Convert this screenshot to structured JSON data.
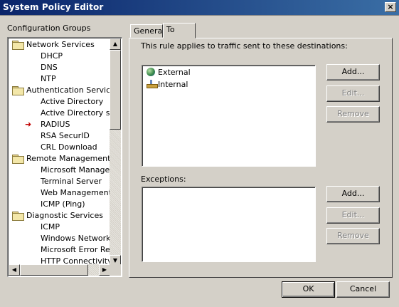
{
  "window": {
    "title": "System Policy Editor",
    "close_glyph": "×"
  },
  "sidebar": {
    "label": "Configuration Groups",
    "items": [
      {
        "text": "Network Services",
        "kind": "folder",
        "level": 0
      },
      {
        "text": "DHCP",
        "kind": "item",
        "level": 1
      },
      {
        "text": "DNS",
        "kind": "item",
        "level": 1
      },
      {
        "text": "NTP",
        "kind": "item",
        "level": 1
      },
      {
        "text": "Authentication Services",
        "kind": "folder",
        "level": 0
      },
      {
        "text": "Active Directory",
        "kind": "item",
        "level": 1
      },
      {
        "text": "Active Directory serv",
        "kind": "item",
        "level": 1
      },
      {
        "text": "RADIUS",
        "kind": "item",
        "level": 1,
        "selected_marker": true
      },
      {
        "text": "RSA SecurID",
        "kind": "item",
        "level": 1
      },
      {
        "text": "CRL Download",
        "kind": "item",
        "level": 1
      },
      {
        "text": "Remote Management",
        "kind": "folder",
        "level": 0
      },
      {
        "text": "Microsoft Manageme",
        "kind": "item",
        "level": 1
      },
      {
        "text": "Terminal Server",
        "kind": "item",
        "level": 1
      },
      {
        "text": "Web Management",
        "kind": "item",
        "level": 1
      },
      {
        "text": "ICMP (Ping)",
        "kind": "item",
        "level": 1
      },
      {
        "text": "Diagnostic Services",
        "kind": "folder",
        "level": 0
      },
      {
        "text": "ICMP",
        "kind": "item",
        "level": 1
      },
      {
        "text": "Windows Networking",
        "kind": "item",
        "level": 1
      },
      {
        "text": "Microsoft Error Repo",
        "kind": "item",
        "level": 1
      },
      {
        "text": "HTTP Connectivity v",
        "kind": "item",
        "level": 1
      }
    ]
  },
  "tabs": [
    {
      "label": "General",
      "active": false
    },
    {
      "label": "To",
      "active": true
    }
  ],
  "panel": {
    "description": "This rule applies to traffic sent to these destinations:",
    "destinations": [
      {
        "text": "External",
        "icon": "globe-icon"
      },
      {
        "text": "Internal",
        "icon": "network-icon"
      }
    ],
    "dest_buttons": {
      "add": "Add...",
      "edit": "Edit...",
      "remove": "Remove"
    },
    "exceptions_label": "Exceptions:",
    "exc_buttons": {
      "add": "Add...",
      "edit": "Edit...",
      "remove": "Remove"
    }
  },
  "footer": {
    "ok": "OK",
    "cancel": "Cancel"
  }
}
